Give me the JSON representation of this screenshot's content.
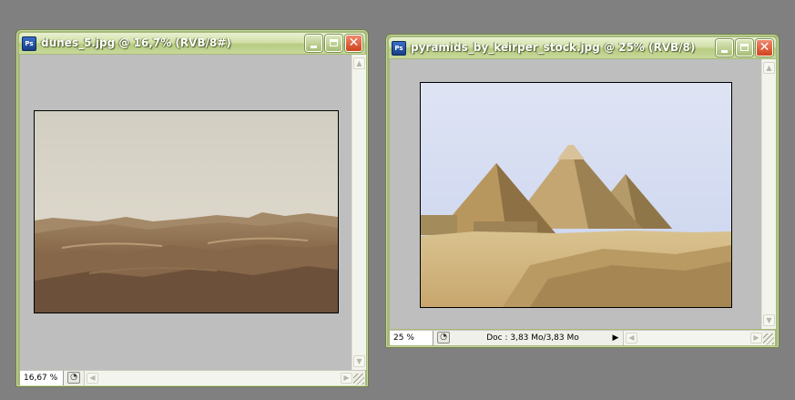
{
  "windows": [
    {
      "title": "dunes_5.jpg @ 16,7% (RVB/8#)",
      "zoom": "16,67 %",
      "icon": "photoshop-document-icon",
      "buttons": {
        "minimize": "minimize-icon",
        "maximize": "maximize-icon",
        "close": "close-icon"
      }
    },
    {
      "title": "pyramids_by_keirper_stock.jpg @ 25% (RVB/8)",
      "zoom": "25 %",
      "doc_info": "Doc : 3,83 Mo/3,83 Mo",
      "icon": "photoshop-document-icon",
      "buttons": {
        "minimize": "minimize-icon",
        "maximize": "maximize-icon",
        "close": "close-icon"
      }
    }
  ],
  "glyphs": {
    "app_icon": "Ps",
    "close": "✕",
    "scroll_up": "▲",
    "scroll_down": "▼",
    "scroll_left": "◀",
    "scroll_right": "▶",
    "status_menu": "▶"
  },
  "colors": {
    "desktop": "#808080",
    "window_frame": "#a6b97a",
    "close_button": "#d0441c",
    "canvas": "#bebebe"
  }
}
